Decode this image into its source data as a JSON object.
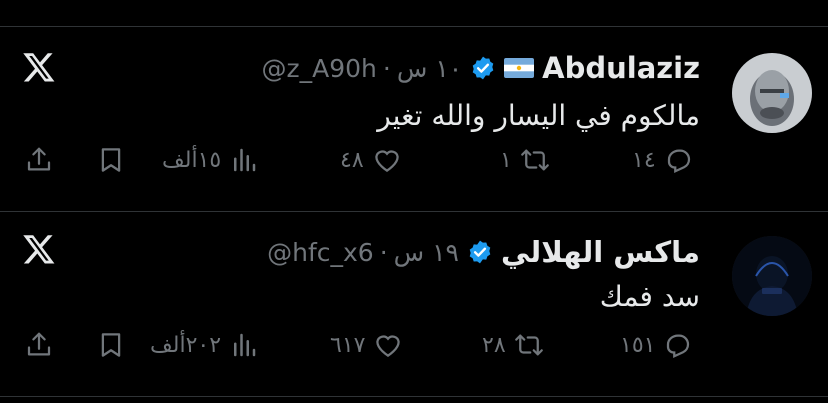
{
  "tweets": [
    {
      "display_name": "Abdulaziz",
      "flag": "🇦🇷",
      "handle": "@z_A90h",
      "separator": "·",
      "time": "١٠ س",
      "text": "مالكوم في اليسار والله تغير",
      "replies": "١٤",
      "retweets": "١",
      "likes": "٤٨",
      "views": "١٥ألف"
    },
    {
      "display_name": "ماكس الهلالي",
      "handle": "@hfc_x6",
      "separator": "·",
      "time": "١٩ س",
      "text": "سد فمك",
      "replies": "١٥١",
      "retweets": "٢٨",
      "likes": "٦١٧",
      "views": "٢٠٢ألف"
    }
  ],
  "icons": {
    "logo": "x-logo-icon",
    "verified": "verified-badge-icon",
    "reply": "reply-icon",
    "retweet": "retweet-icon",
    "like": "heart-icon",
    "views": "views-icon",
    "bookmark": "bookmark-icon",
    "share": "share-icon"
  },
  "colors": {
    "background": "#000000",
    "text": "#e7e9ea",
    "muted": "#71767b",
    "verified": "#1d9bf0",
    "divider": "#2f3336"
  }
}
